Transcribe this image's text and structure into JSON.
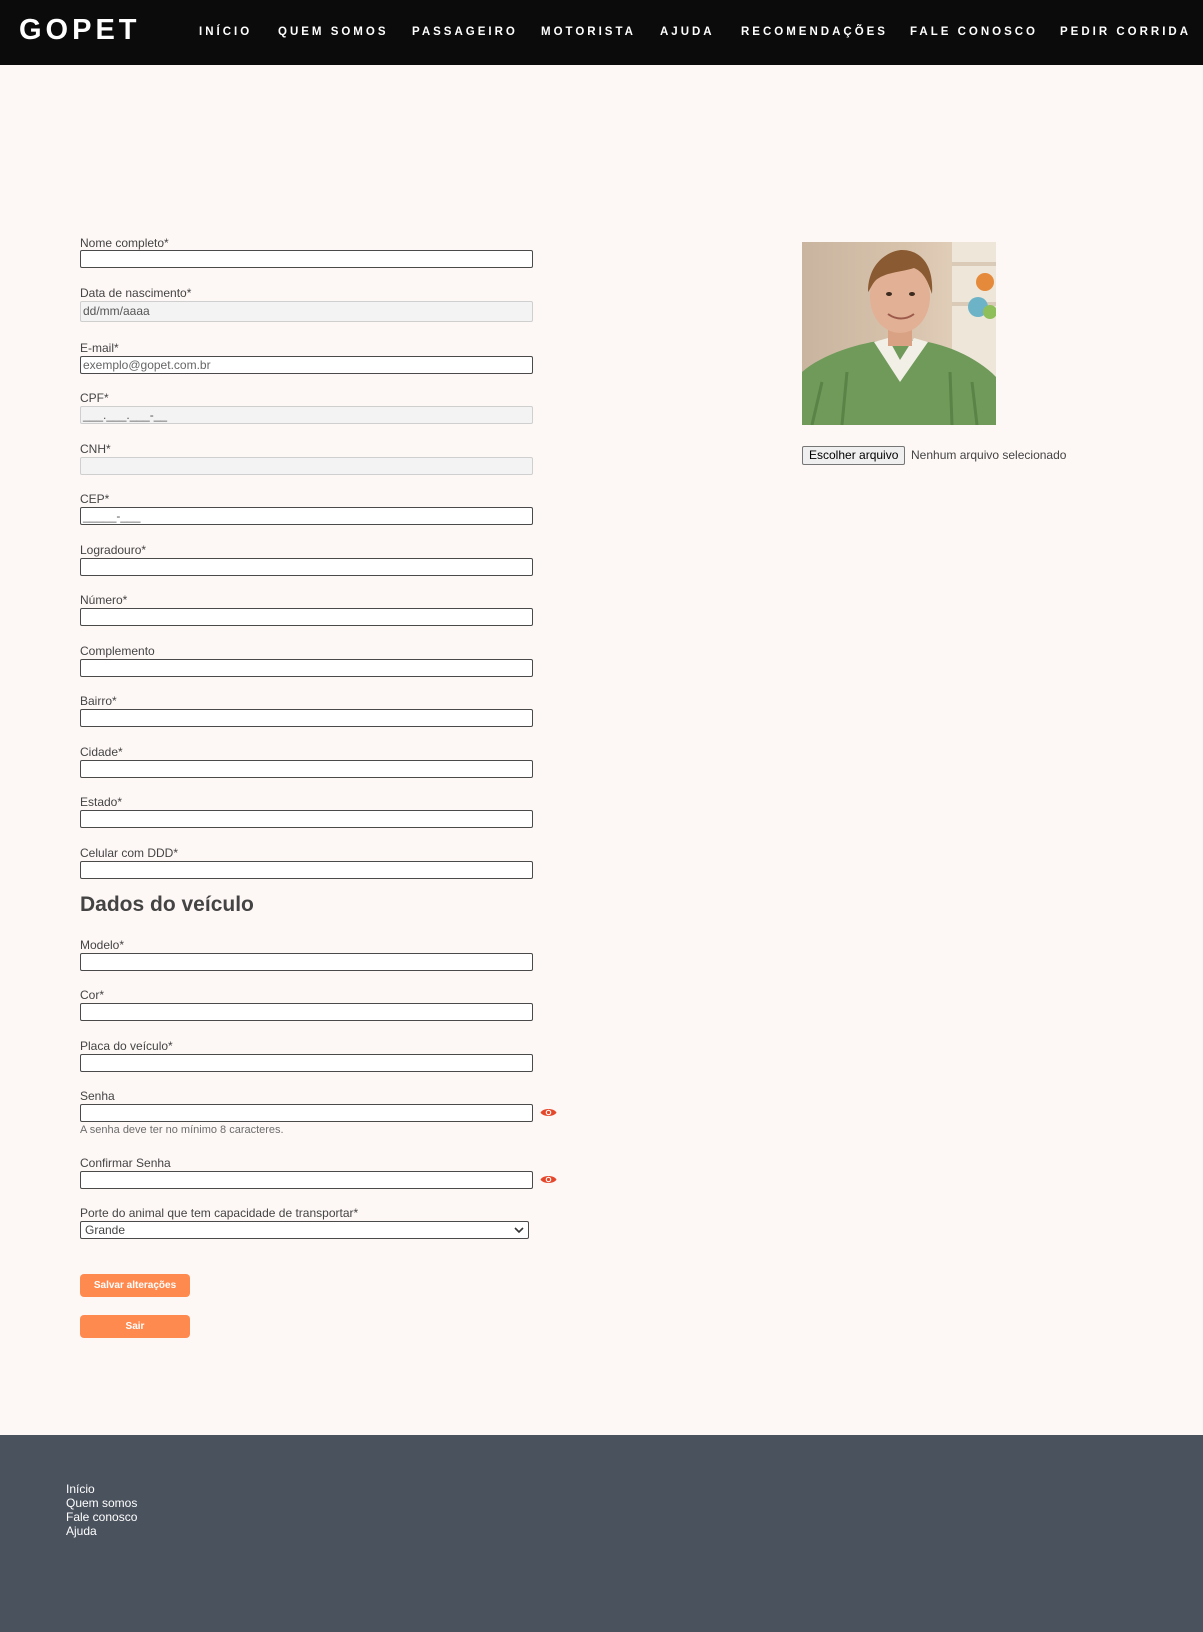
{
  "brand": {
    "logo": "GOPET"
  },
  "nav": {
    "items": [
      {
        "label": "INÍCIO"
      },
      {
        "label": "QUEM SOMOS"
      },
      {
        "label": "PASSAGEIRO"
      },
      {
        "label": "MOTORISTA"
      },
      {
        "label": "AJUDA"
      },
      {
        "label": "RECOMENDAÇÕES"
      },
      {
        "label": "FALE CONOSCO"
      },
      {
        "label": "PEDIR CORRIDA"
      }
    ]
  },
  "form": {
    "fields": [
      {
        "label": "Nome completo*",
        "value": "",
        "placeholder": ""
      },
      {
        "label": "Data de nascimento*",
        "value": "dd/mm/aaaa",
        "placeholder": ""
      },
      {
        "label": "E-mail*",
        "value": "",
        "placeholder": "exemplo@gopet.com.br"
      },
      {
        "label": "CPF*",
        "value": "___.___.___-__",
        "placeholder": ""
      },
      {
        "label": "CNH*",
        "value": "",
        "placeholder": ""
      },
      {
        "label": "CEP*",
        "value": "_____-___",
        "placeholder": ""
      },
      {
        "label": "Logradouro*",
        "value": "",
        "placeholder": ""
      },
      {
        "label": "Número*",
        "value": "",
        "placeholder": ""
      },
      {
        "label": "Complemento",
        "value": "",
        "placeholder": ""
      },
      {
        "label": "Bairro*",
        "value": "",
        "placeholder": ""
      },
      {
        "label": "Cidade*",
        "value": "",
        "placeholder": ""
      },
      {
        "label": "Estado*",
        "value": "",
        "placeholder": ""
      },
      {
        "label": "Celular com DDD*",
        "value": "",
        "placeholder": ""
      }
    ],
    "vehicle_section_title": "Dados do veículo",
    "vehicle_fields": [
      {
        "label": "Modelo*",
        "value": ""
      },
      {
        "label": "Cor*",
        "value": ""
      },
      {
        "label": "Placa do veículo*",
        "value": ""
      }
    ],
    "password": {
      "label": "Senha",
      "value": "",
      "hint": "A senha deve ter no mínimo 8 caracteres."
    },
    "confirm_password": {
      "label": "Confirmar Senha",
      "value": ""
    },
    "animal_size": {
      "label": "Porte do animal que tem capacidade de transportar*",
      "selected": "Grande"
    },
    "save_label": "Salvar alterações",
    "logout_label": "Sair"
  },
  "profile": {
    "file_button_label": "Escolher arquivo",
    "file_status": "Nenhum arquivo selecionado"
  },
  "footer": {
    "links": [
      {
        "label": "Início"
      },
      {
        "label": "Quem somos"
      },
      {
        "label": "Fale conosco"
      },
      {
        "label": "Ajuda"
      }
    ]
  },
  "colors": {
    "navbar": "#0b0b0b",
    "page_bg": "#fdf8f6",
    "accent": "#ff8a4f",
    "eye_icon": "#e5472b",
    "footer": "#4a525e"
  },
  "icons": [
    "eye-icon",
    "chevron-down-icon",
    "profile-photo"
  ]
}
